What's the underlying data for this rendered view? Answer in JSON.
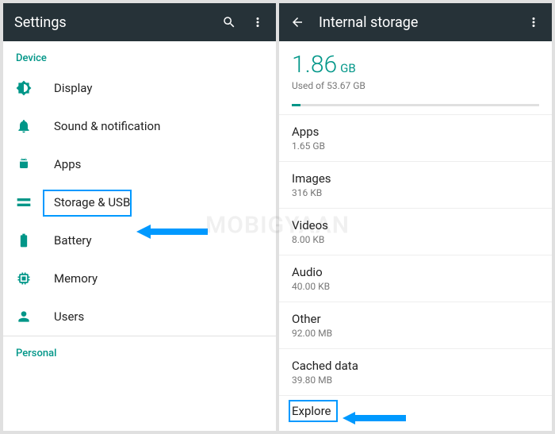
{
  "left": {
    "title": "Settings",
    "section1": "Device",
    "section2": "Personal",
    "items": [
      {
        "label": "Display"
      },
      {
        "label": "Sound & notification"
      },
      {
        "label": "Apps"
      },
      {
        "label": "Storage & USB"
      },
      {
        "label": "Battery"
      },
      {
        "label": "Memory"
      },
      {
        "label": "Users"
      }
    ]
  },
  "right": {
    "title": "Internal storage",
    "used_value": "1.86",
    "used_unit": "GB",
    "used_sub": "Used of 53.67 GB",
    "progress_pct": 3.5,
    "rows": [
      {
        "name": "Apps",
        "size": "1.65 GB"
      },
      {
        "name": "Images",
        "size": "316 KB"
      },
      {
        "name": "Videos",
        "size": "8.00 KB"
      },
      {
        "name": "Audio",
        "size": "40.00 KB"
      },
      {
        "name": "Other",
        "size": "92.00 MB"
      },
      {
        "name": "Cached data",
        "size": "39.80 MB"
      }
    ],
    "explore": "Explore"
  },
  "watermark": "MOBIGYAAN",
  "colors": {
    "teal": "#009688",
    "arrow": "#0099ff",
    "appbar": "#263238"
  }
}
